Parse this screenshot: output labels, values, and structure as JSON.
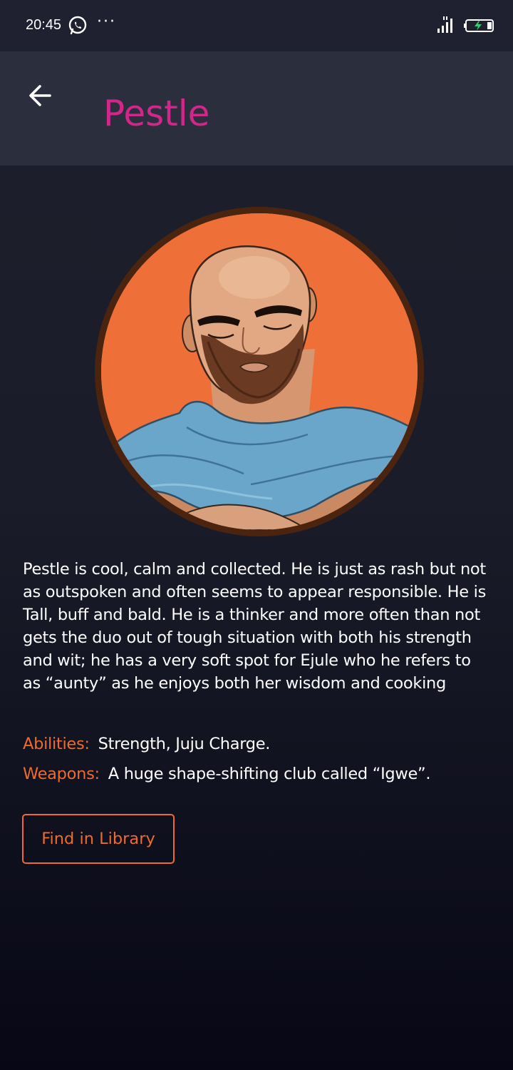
{
  "status_bar": {
    "time": "20:45",
    "more_indicator": "···",
    "icons": [
      "whatsapp-icon",
      "signal-icon",
      "battery-charging-icon"
    ]
  },
  "header": {
    "back_icon": "arrow-left-icon",
    "title": "Pestle"
  },
  "character": {
    "avatar": "pestle-portrait",
    "description": "Pestle is cool, calm and collected. He is just as rash but not as outspoken and often seems to appear responsible. He is Tall, buff and bald. He is a thinker and more often than not gets the duo out of tough situation with both his strength and wit; he has a very soft spot for Ejule who he refers to as “aunty” as he enjoys both her wisdom and cooking",
    "abilities_label": "Abilities:",
    "abilities_value": "Strength,  Juju Charge.",
    "weapons_label": "Weapons:",
    "weapons_value": "A huge shape-shifting club called “Igwe”."
  },
  "actions": {
    "find_in_library_label": "Find in Library"
  },
  "colors": {
    "title": "#d2268a",
    "accent": "#ef6a2d",
    "app_bar": "#2b2e3d",
    "avatar_background": "#ee7038",
    "avatar_ring": "#4b2410"
  }
}
